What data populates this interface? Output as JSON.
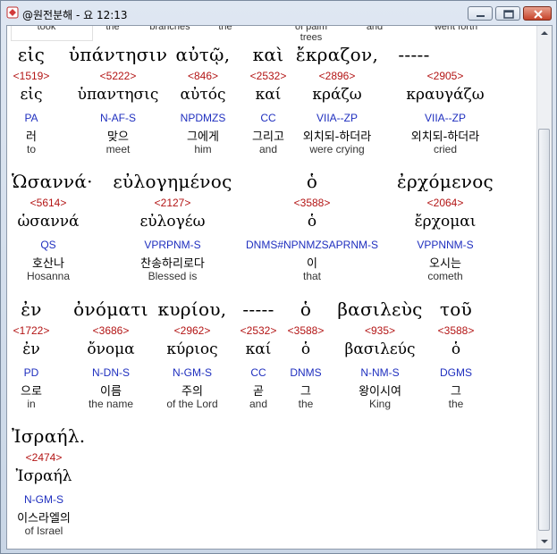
{
  "window": {
    "title": "@원전분해 - 요 12:13"
  },
  "clipped_top": [
    "took",
    "the",
    "branches",
    "the",
    "of palm trees",
    "and",
    "went forth"
  ],
  "rows": [
    {
      "words": [
        {
          "greek": "εἰς",
          "strongs": "<1519>",
          "lemma": "εἰς",
          "parsing": "PA",
          "korean": "러",
          "english": "to"
        },
        {
          "greek": "ὑπάντησιν",
          "strongs": "<5222>",
          "lemma": "ὑπαντησις",
          "parsing": "N-AF-S",
          "korean": "맞으",
          "english": "meet"
        },
        {
          "greek": "αὐτῷ,",
          "strongs": "<846>",
          "lemma": "αὐτός",
          "parsing": "NPDMZS",
          "korean": "그에게",
          "english": "him"
        },
        {
          "greek": "καὶ",
          "strongs": "<2532>",
          "lemma": "καί",
          "parsing": "CC",
          "korean": "그리고",
          "english": "and"
        },
        {
          "greek": "ἔκραζον,",
          "strongs": "<2896>",
          "lemma": "κράζω",
          "parsing": "VIIA--ZP",
          "korean": "외치되-하더라",
          "english": "were crying"
        },
        {
          "greek": "-----",
          "strongs": "<2905>",
          "lemma": "κραυγάζω",
          "parsing": "VIIA--ZP",
          "korean": "외치되-하더라",
          "english": "cried"
        }
      ]
    },
    {
      "words": [
        {
          "greek": "Ὡσαννά·",
          "strongs": "<5614>",
          "lemma": "ὡσαννά",
          "parsing": "QS",
          "korean": "호산나",
          "english": "Hosanna"
        },
        {
          "greek": "εὐλογημένος",
          "strongs": "<2127>",
          "lemma": "εὐλογέω",
          "parsing": "VPRPNM-S",
          "korean": "찬송하리로다",
          "english": "Blessed is"
        },
        {
          "greek": "ὁ",
          "strongs": "<3588>",
          "lemma": "ὁ",
          "parsing": "DNMS#NPNMZSAPRNM-S",
          "korean": "이",
          "english": "that"
        },
        {
          "greek": "ἐρχόμενος",
          "strongs": "<2064>",
          "lemma": "ἔρχομαι",
          "parsing": "VPPNNM-S",
          "korean": "오시는",
          "english": "cometh"
        }
      ]
    },
    {
      "words": [
        {
          "greek": "ἐν",
          "strongs": "<1722>",
          "lemma": "ἐν",
          "parsing": "PD",
          "korean": "으로",
          "english": "in"
        },
        {
          "greek": "ὀνόματι",
          "strongs": "<3686>",
          "lemma": "ὄνομα",
          "parsing": "N-DN-S",
          "korean": "이름",
          "english": "the name"
        },
        {
          "greek": "κυρίου,",
          "strongs": "<2962>",
          "lemma": "κύριος",
          "parsing": "N-GM-S",
          "korean": "주의",
          "english": "of the Lord"
        },
        {
          "greek": "-----",
          "strongs": "<2532>",
          "lemma": "καί",
          "parsing": "CC",
          "korean": "곧",
          "english": "and"
        },
        {
          "greek": "ὁ",
          "strongs": "<3588>",
          "lemma": "ὁ",
          "parsing": "DNMS",
          "korean": "그",
          "english": "the"
        },
        {
          "greek": "βασιλεὺς",
          "strongs": "<935>",
          "lemma": "βασιλεύς",
          "parsing": "N-NM-S",
          "korean": "왕이시여",
          "english": "King"
        },
        {
          "greek": "τοῦ",
          "strongs": "<3588>",
          "lemma": "ὁ",
          "parsing": "DGMS",
          "korean": "그",
          "english": "the"
        }
      ]
    },
    {
      "words": [
        {
          "greek": "Ἰσραήλ.",
          "strongs": "<2474>",
          "lemma": "Ἰσραήλ",
          "parsing": "N-GM-S",
          "korean": "이스라엘의",
          "english": "of Israel"
        }
      ]
    }
  ]
}
